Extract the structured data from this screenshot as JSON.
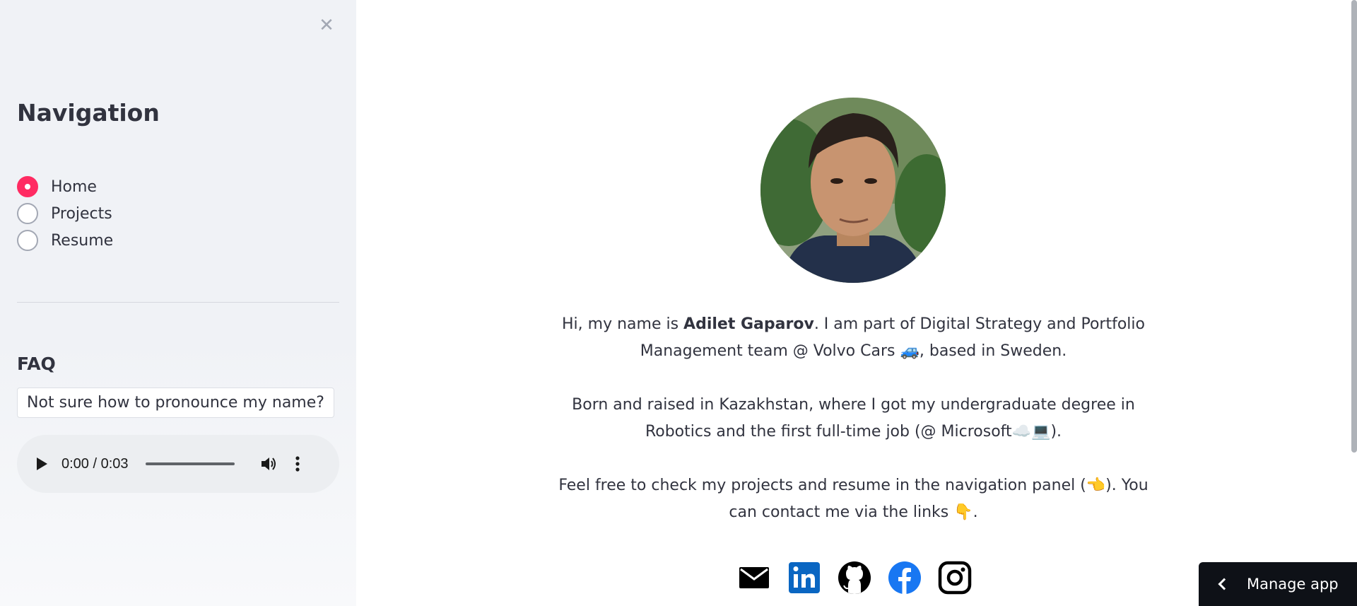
{
  "sidebar": {
    "close_icon": "close-icon",
    "nav_title": "Navigation",
    "nav_items": [
      {
        "label": "Home",
        "selected": true
      },
      {
        "label": "Projects",
        "selected": false
      },
      {
        "label": "Resume",
        "selected": false
      }
    ],
    "faq_title": "FAQ",
    "faq_question": "Not sure how to pronounce my name?",
    "audio": {
      "time": "0:00 / 0:03",
      "progress": 0
    }
  },
  "main": {
    "intro": {
      "p1_pre": "Hi, my name is ",
      "p1_name": "Adilet Gaparov",
      "p1_post": ". I am part of Digital Strategy and Portfolio Management team @ Volvo Cars 🚙, based in Sweden.",
      "p2": "Born and raised in Kazakhstan, where I got my undergraduate degree in Robotics and the first full-time job (@ Microsoft☁️💻).",
      "p3": "Feel free to check my projects and resume in the navigation panel (👈). You can contact me via the links 👇."
    },
    "social_icons": [
      "email-icon",
      "linkedin-icon",
      "github-icon",
      "facebook-icon",
      "instagram-icon"
    ]
  },
  "manage_app": {
    "label": "Manage app"
  },
  "colors": {
    "accent": "#ff2b62",
    "sidebar_bg": "#f0f2f6",
    "text": "#31333f",
    "manage_bg": "#0e1117",
    "linkedin": "#0a66c2",
    "facebook": "#1877f2"
  }
}
